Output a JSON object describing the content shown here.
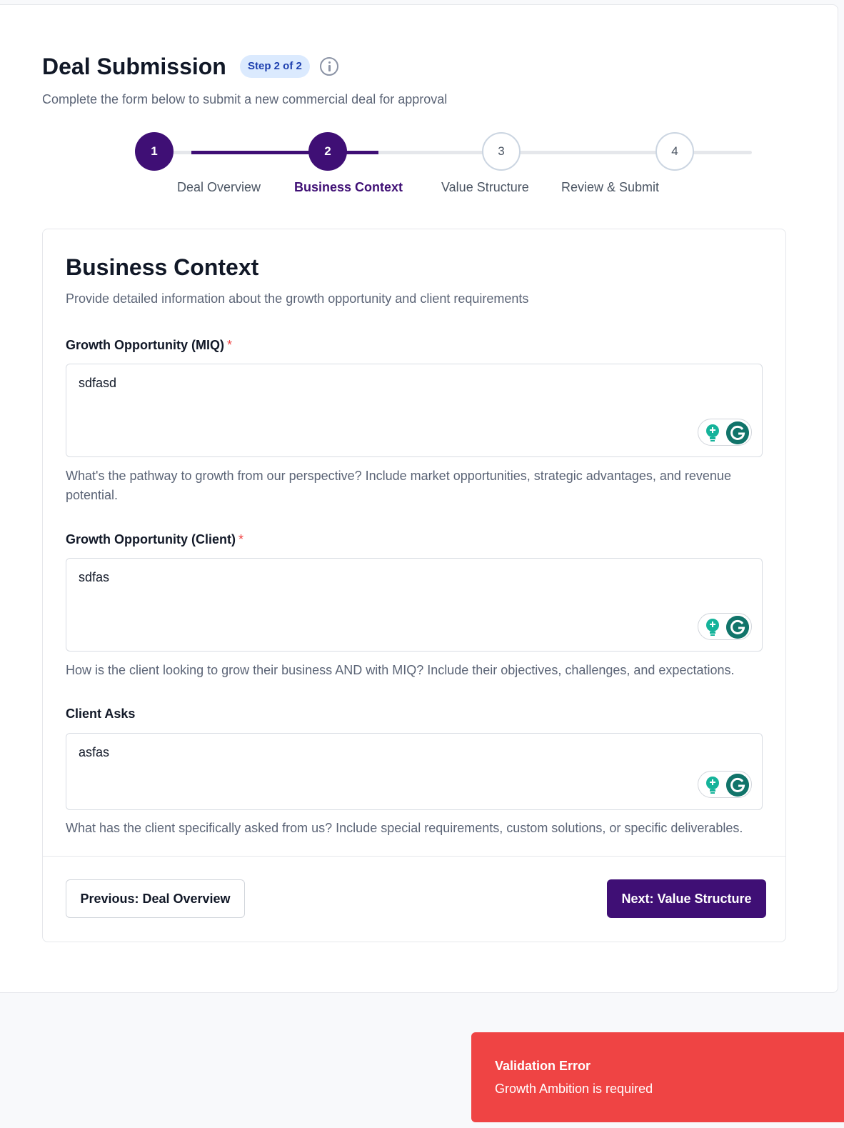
{
  "header": {
    "title": "Deal Submission",
    "step_badge": "Step 2 of 2",
    "subtitle": "Complete the form below to submit a new commercial deal for approval"
  },
  "stepper": {
    "steps": [
      {
        "number": "1",
        "label": "Deal Overview",
        "state": "completed"
      },
      {
        "number": "2",
        "label": "Business Context",
        "state": "current"
      },
      {
        "number": "3",
        "label": "Value Structure",
        "state": "upcoming"
      },
      {
        "number": "4",
        "label": "Review & Submit",
        "state": "upcoming"
      }
    ]
  },
  "section": {
    "title": "Business Context",
    "subtitle": "Provide detailed information about the growth opportunity and client requirements"
  },
  "fields": [
    {
      "label": "Growth Opportunity (MIQ)",
      "required_mark": "*",
      "value": "sdfasd",
      "helper": "What's the pathway to growth from our perspective? Include market opportunities, strategic advantages, and revenue potential."
    },
    {
      "label": "Growth Opportunity (Client)",
      "required_mark": "*",
      "value": "sdfas",
      "helper": "How is the client looking to grow their business AND with MIQ? Include their objectives, challenges, and expectations."
    },
    {
      "label": "Client Asks",
      "required_mark": "",
      "value": "asfas",
      "helper": "What has the client specifically asked from us? Include special requirements, custom solutions, or specific deliverables."
    }
  ],
  "actions": {
    "previous_label": "Previous: Deal Overview",
    "next_label": "Next: Value Structure"
  },
  "toast": {
    "title": "Validation Error",
    "message": "Growth Ambition is required"
  },
  "colors": {
    "primary": "#3f0f75",
    "badge_bg": "#dbeafe",
    "error": "#ef4444",
    "grammarly": "#11746a",
    "bulb": "#15b39a"
  }
}
